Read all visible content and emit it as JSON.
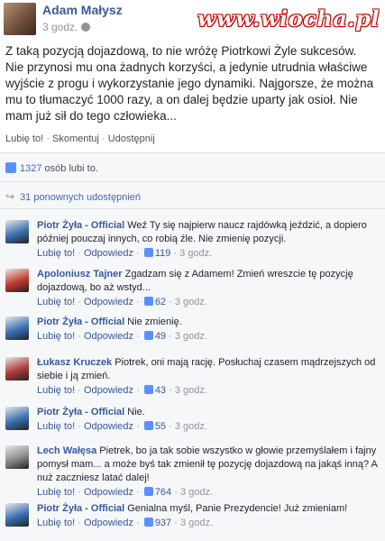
{
  "post": {
    "author": "Adam Małysz",
    "time": "3 godz.",
    "watermark": "www.wiocha.pl",
    "text": "Z taką pozycją dojazdową, to nie wróżę Piotrkowi Żyle sukcesów. Nie przynosi mu ona żadnych korzyści, a jedynie utrudnia właściwe wyjście z progu i wykorzystanie jego dynamiki. Najgorsze, że można mu to tłumaczyć 1000 razy, a on dalej będzie uparty jak osioł. Nie mam już sił do tego człowieka...",
    "actions": {
      "like": "Lubię to!",
      "sep": "·",
      "comment": "Skomentuj",
      "share": "Udostępnij"
    }
  },
  "likes": {
    "count": "1327",
    "text": "osób lubi to."
  },
  "shares": {
    "text": "31 ponownych udostępnień"
  },
  "comments": [
    {
      "author": "Piotr Żyła - Official",
      "text": "Weź Ty się najpierw naucz rajdówką jeździć, a dopiero później pouczaj innych, co robią źle. Nie zmienię pozycji.",
      "like": "Lubię to!",
      "reply": "Odpowiedz",
      "likes": "119",
      "time": "3 godz.",
      "avatar_color": "#3a6fb0"
    },
    {
      "author": "Apoloniusz Tajner",
      "text": "Zgadzam się z Adamem! Zmień wreszcie tę pozycję dojazdową, bo aż wstyd...",
      "like": "Lubię to!",
      "reply": "Odpowiedz",
      "likes": "62",
      "time": "3 godz.",
      "avatar_color": "#c0392b"
    },
    {
      "author": "Piotr Żyła - Official",
      "text": "Nie zmienię.",
      "like": "Lubię to!",
      "reply": "Odpowiedz",
      "likes": "49",
      "time": "3 godz.",
      "avatar_color": "#3a6fb0"
    },
    {
      "author": "Łukasz Kruczek",
      "text": "Piotrek, oni mają rację. Posłuchaj czasem mądrzejszych od siebie i ją zmień.",
      "like": "Lubię to!",
      "reply": "Odpowiedz",
      "likes": "43",
      "time": "3 godz.",
      "avatar_color": "#b03a3a"
    },
    {
      "author": "Piotr Żyła - Official",
      "text": "Nie.",
      "like": "Lubię to!",
      "reply": "Odpowiedz",
      "likes": "55",
      "time": "3 godz.",
      "avatar_color": "#3a6fb0"
    },
    {
      "author": "Lech Wałęsa",
      "text": "Pietrek, bo ja tak sobie wszystko w głowie przemyślałem i fajny pomysł mam... a może byś tak zmienił tę pozycję dojazdową na jakąś inną? A nuż zaczniesz latać dalej!",
      "like": "Lubię to!",
      "reply": "Odpowiedz",
      "likes": "764",
      "time": "3 godz.",
      "avatar_color": "#8a8a8a"
    },
    {
      "author": "Piotr Żyła - Official",
      "text": "Genialna myśl, Panie Prezydencie! Już zmieniam!",
      "like": "Lubię to!",
      "reply": "Odpowiedz",
      "likes": "937",
      "time": "3 godz.",
      "avatar_color": "#3a6fb0"
    }
  ]
}
